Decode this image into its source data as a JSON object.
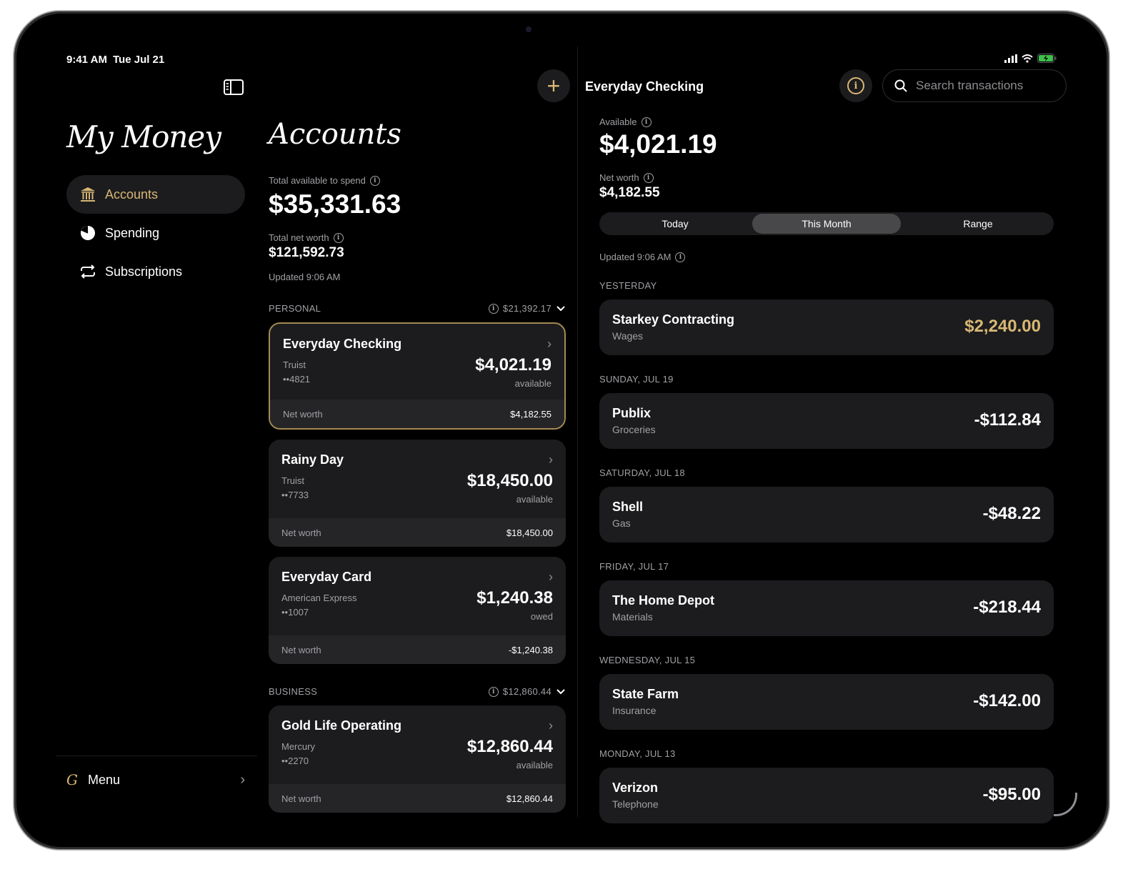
{
  "status_bar": {
    "time": "9:41 AM",
    "date": "Tue Jul 21"
  },
  "sidebar": {
    "brand": "My Money",
    "items": [
      {
        "label": "Accounts",
        "icon": "bank-icon",
        "active": true
      },
      {
        "label": "Spending",
        "icon": "pie-chart-icon",
        "active": false
      },
      {
        "label": "Subscriptions",
        "icon": "repeat-icon",
        "active": false
      }
    ],
    "menu": {
      "logo": "G",
      "label": "Menu"
    }
  },
  "accounts": {
    "title": "Accounts",
    "total_available_label": "Total available to spend",
    "total_available": "$35,331.63",
    "total_net_worth_label": "Total net worth",
    "total_net_worth": "$121,592.73",
    "updated": "Updated 9:06 AM",
    "personal": {
      "label": "PERSONAL",
      "total": "$21,392.17",
      "cards": [
        {
          "name": "Everyday Checking",
          "institution": "Truist",
          "number": "••4821",
          "amount": "$4,021.19",
          "amount_label": "available",
          "net_worth_label": "Net worth",
          "net_worth": "$4,182.55"
        },
        {
          "name": "Rainy Day",
          "institution": "Truist",
          "number": "••7733",
          "amount": "$18,450.00",
          "amount_label": "available",
          "net_worth_label": "Net worth",
          "net_worth": "$18,450.00"
        },
        {
          "name": "Everyday Card",
          "institution": "American Express",
          "number": "••1007",
          "amount": "$1,240.38",
          "amount_label": "owed",
          "net_worth_label": "Net worth",
          "net_worth": "-$1,240.38"
        }
      ]
    },
    "business": {
      "label": "BUSINESS",
      "total": "$12,860.44",
      "cards": [
        {
          "name": "Gold Life Operating",
          "institution": "Mercury",
          "number": "••2270",
          "amount": "$12,860.44",
          "amount_label": "available",
          "net_worth_label": "Net worth",
          "net_worth": "$12,860.44"
        }
      ]
    }
  },
  "detail": {
    "title": "Everyday Checking",
    "search_placeholder": "Search transactions",
    "available_label": "Available",
    "available": "$4,021.19",
    "net_worth_label": "Net worth",
    "net_worth": "$4,182.55",
    "segments": [
      "Today",
      "This Month",
      "Range"
    ],
    "active_segment": "This Month",
    "updated": "Updated 9:06 AM",
    "groups": [
      {
        "heading": "YESTERDAY",
        "tx": {
          "name": "Starkey Contracting",
          "category": "Wages",
          "amount": "$2,240.00",
          "positive": true
        }
      },
      {
        "heading": "SUNDAY, JUL 19",
        "tx": {
          "name": "Publix",
          "category": "Groceries",
          "amount": "-$112.84",
          "positive": false
        }
      },
      {
        "heading": "SATURDAY, JUL 18",
        "tx": {
          "name": "Shell",
          "category": "Gas",
          "amount": "-$48.22",
          "positive": false
        }
      },
      {
        "heading": "FRIDAY, JUL 17",
        "tx": {
          "name": "The Home Depot",
          "category": "Materials",
          "amount": "-$218.44",
          "positive": false
        }
      },
      {
        "heading": "WEDNESDAY, JUL 15",
        "tx": {
          "name": "State Farm",
          "category": "Insurance",
          "amount": "-$142.00",
          "positive": false
        }
      },
      {
        "heading": "MONDAY, JUL 13",
        "tx": {
          "name": "Verizon",
          "category": "Telephone",
          "amount": "-$95.00",
          "positive": false
        }
      }
    ]
  },
  "colors": {
    "accent_gold": "#d8b774",
    "card_bg": "#1c1c1e",
    "background": "#000000"
  }
}
